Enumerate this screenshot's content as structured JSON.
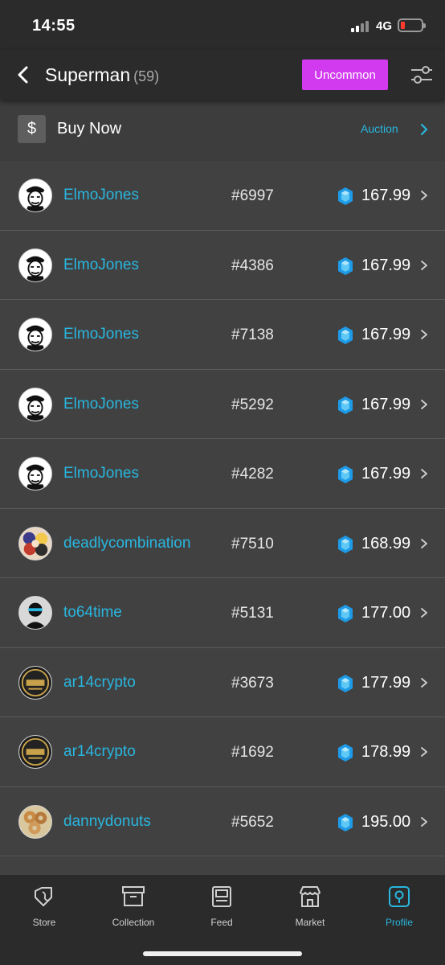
{
  "status_bar": {
    "time": "14:55",
    "network": "4G"
  },
  "header": {
    "title": "Superman",
    "count": "(59)",
    "rarity_button": "Uncommon"
  },
  "buy_bar": {
    "buy_label": "Buy Now",
    "auction_label": "Auction",
    "dollar_symbol": "$"
  },
  "listings": [
    {
      "user": "ElmoJones",
      "serial": "#6997",
      "price": "167.99",
      "avatar": "elmo"
    },
    {
      "user": "ElmoJones",
      "serial": "#4386",
      "price": "167.99",
      "avatar": "elmo"
    },
    {
      "user": "ElmoJones",
      "serial": "#7138",
      "price": "167.99",
      "avatar": "elmo"
    },
    {
      "user": "ElmoJones",
      "serial": "#5292",
      "price": "167.99",
      "avatar": "elmo"
    },
    {
      "user": "ElmoJones",
      "serial": "#4282",
      "price": "167.99",
      "avatar": "elmo"
    },
    {
      "user": "deadlycombination",
      "serial": "#7510",
      "price": "168.99",
      "avatar": "anime"
    },
    {
      "user": "to64time",
      "serial": "#5131",
      "price": "177.00",
      "avatar": "masked"
    },
    {
      "user": "ar14crypto",
      "serial": "#3673",
      "price": "177.99",
      "avatar": "badge"
    },
    {
      "user": "ar14crypto",
      "serial": "#1692",
      "price": "178.99",
      "avatar": "badge"
    },
    {
      "user": "dannydonuts",
      "serial": "#5652",
      "price": "195.00",
      "avatar": "donut"
    }
  ],
  "tabs": [
    {
      "label": "Store",
      "icon": "tag-icon",
      "active": false
    },
    {
      "label": "Collection",
      "icon": "box-icon",
      "active": false
    },
    {
      "label": "Feed",
      "icon": "feed-icon",
      "active": false
    },
    {
      "label": "Market",
      "icon": "storefront-icon",
      "active": false
    },
    {
      "label": "Profile",
      "icon": "profile-icon",
      "active": true
    }
  ],
  "colors": {
    "accent": "#29b6df",
    "rarity": "#d23af0",
    "background": "#414141",
    "header": "#2b2b2b",
    "gem": "#1e9be8"
  }
}
